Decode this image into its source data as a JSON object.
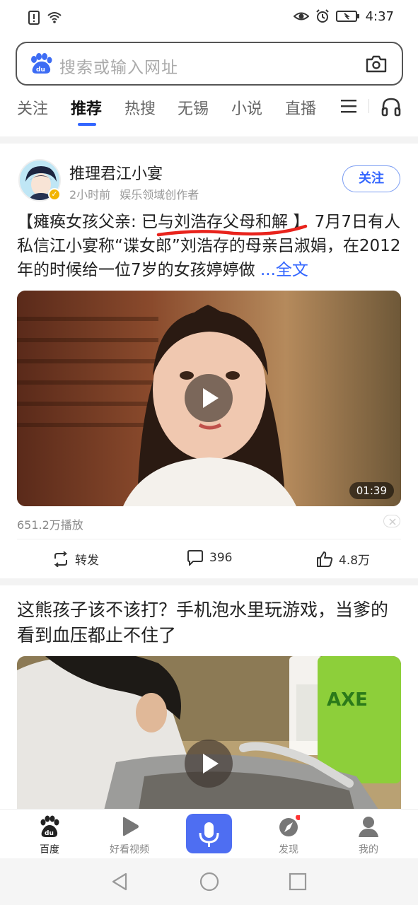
{
  "status_bar": {
    "time": "4:37"
  },
  "search": {
    "placeholder": "搜索或输入网址"
  },
  "tabs": [
    {
      "label": "关注"
    },
    {
      "label": "推荐"
    },
    {
      "label": "热搜"
    },
    {
      "label": "无锡"
    },
    {
      "label": "小说"
    },
    {
      "label": "直播"
    }
  ],
  "post1": {
    "author": "推理君江小宴",
    "time": "2小时前",
    "author_desc": "娱乐领域创作者",
    "follow_label": "关注",
    "text": "【瘫痪女孩父亲: 已与刘浩存父母和解 】 7月7日有人私信江小宴称“谍女郎”刘浩存的母亲吕淑娟，在2012年的时候给一位7岁的女孩婷婷做 ",
    "more_label": "...全文",
    "video_duration": "01:39",
    "plays": "651.2万播放",
    "share_label": "转发",
    "comments": "396",
    "likes": "4.8万"
  },
  "post2": {
    "title": "这熊孩子该不该打？手机泡水里玩游戏，当爹的看到血压都止不住了"
  },
  "bottom_nav": {
    "items": [
      {
        "label": "百度"
      },
      {
        "label": "好看视频"
      },
      {
        "label": "发现"
      },
      {
        "label": "我的"
      }
    ]
  },
  "colors": {
    "accent": "#3366ff",
    "mic_bg": "#4e6ef2",
    "badge_red": "#ff3333"
  }
}
